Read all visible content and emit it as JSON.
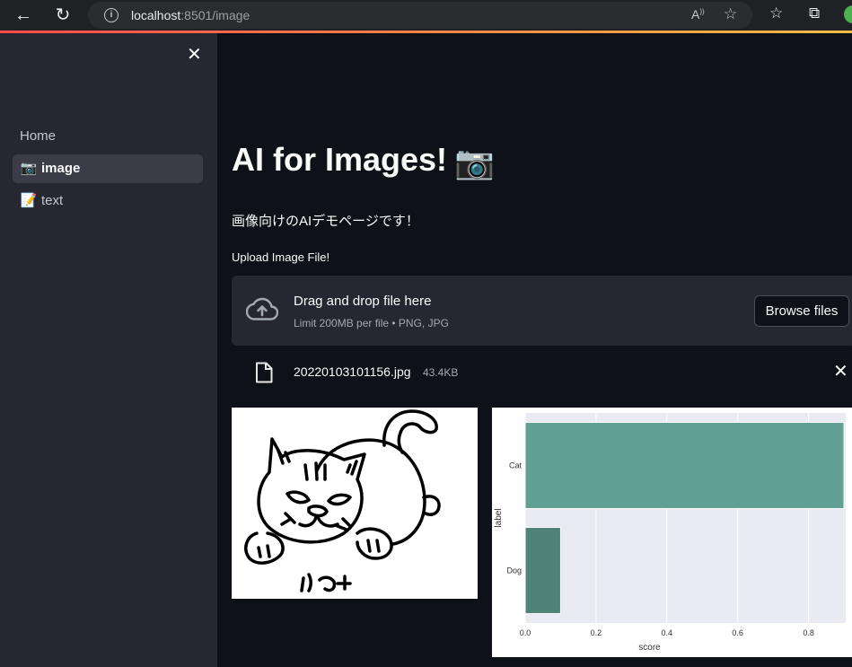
{
  "browser": {
    "url_host": "localhost",
    "url_rest": ":8501/image",
    "icons": [
      "back-icon",
      "reload-icon",
      "info-icon",
      "read-aloud-icon",
      "add-favorite-icon",
      "favorites-icon",
      "collections-icon"
    ]
  },
  "sidebar": {
    "close_glyph": "✕",
    "items": [
      {
        "label": "Home",
        "emoji": ""
      },
      {
        "label": "image",
        "emoji": "📷"
      },
      {
        "label": "text",
        "emoji": "📝"
      }
    ]
  },
  "main": {
    "title": "AI for Images!",
    "title_emoji": "📷",
    "subtitle": "画像向けのAIデモページです！",
    "upload_label": "Upload Image File!",
    "dropzone": {
      "title": "Drag and drop file here",
      "limit": "Limit 200MB per file • PNG, JPG",
      "browse_label": "Browse files"
    },
    "file": {
      "name": "20220103101156.jpg",
      "size": "43.4KB"
    },
    "image_caption": "にゃー"
  },
  "colors": {
    "accent_start": "#ff4b4b",
    "accent_end": "#ffbd45",
    "cat_bar": "#5fa092",
    "dog_bar": "#4f8378",
    "plot_bg": "#eaeaf2"
  },
  "chart_data": {
    "type": "bar",
    "orientation": "horizontal",
    "categories": [
      "Cat",
      "Dog"
    ],
    "values": [
      0.9,
      0.1
    ],
    "xlabel": "score",
    "ylabel": "label",
    "xlim": [
      0,
      0.9
    ],
    "xticks": [
      "0.0",
      "0.2",
      "0.4",
      "0.6",
      "0.8"
    ],
    "grid": true
  }
}
